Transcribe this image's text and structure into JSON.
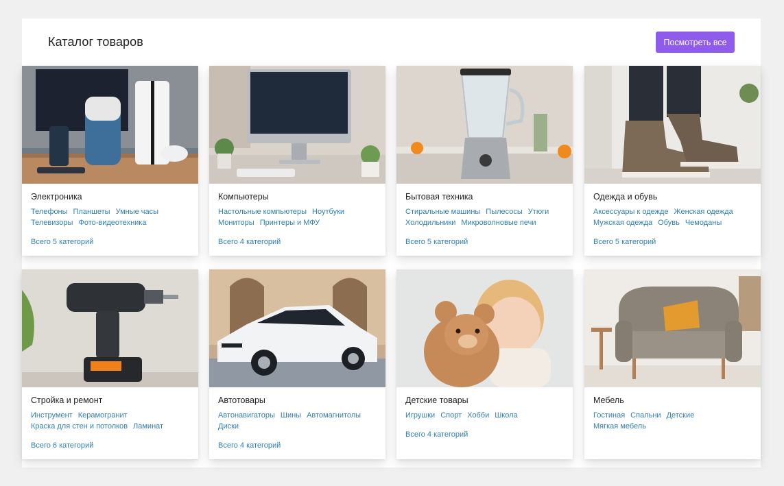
{
  "header": {
    "title": "Каталог товаров",
    "view_all_label": "Посмотреть все"
  },
  "colors": {
    "accent": "#8e5bea",
    "link": "#2f7fb1"
  },
  "categories": [
    {
      "name": "Электроника",
      "links": [
        "Телефоны",
        "Планшеты",
        "Умные часы",
        "Телевизоры",
        "Фото-видеотехника"
      ],
      "total": "Всего 5 категорий"
    },
    {
      "name": "Компьютеры",
      "links": [
        "Настольные компьютеры",
        "Ноутбуки",
        "Мониторы",
        "Принтеры и МФУ"
      ],
      "total": "Всего 4 категорий"
    },
    {
      "name": "Бытовая техника",
      "links": [
        "Стиральные машины",
        "Пылесосы",
        "Утюги",
        "Холодильники",
        "Микроволновые печи"
      ],
      "total": "Всего 5 категорий"
    },
    {
      "name": "Одежда и обувь",
      "links": [
        "Аксессуары к одежде",
        "Женская одежда",
        "Мужская одежда",
        "Обувь",
        "Чемоданы"
      ],
      "total": "Всего 5 категорий"
    },
    {
      "name": "Стройка и ремонт",
      "links": [
        "Инструмент",
        "Керамогранит",
        "Краска для стен и потолков",
        "Ламинат"
      ],
      "total": "Всего 6 категорий"
    },
    {
      "name": "Автотовары",
      "links": [
        "Автонавигаторы",
        "Шины",
        "Автомагнитолы",
        "Диски"
      ],
      "total": "Всего 4 категорий"
    },
    {
      "name": "Детские товары",
      "links": [
        "Игрушки",
        "Спорт",
        "Хобби",
        "Школа"
      ],
      "total": "Всего 4 категорий"
    },
    {
      "name": "Мебель",
      "links": [
        "Гостиная",
        "Спальни",
        "Детские",
        "Мягкая мебель"
      ],
      "total": ""
    }
  ]
}
